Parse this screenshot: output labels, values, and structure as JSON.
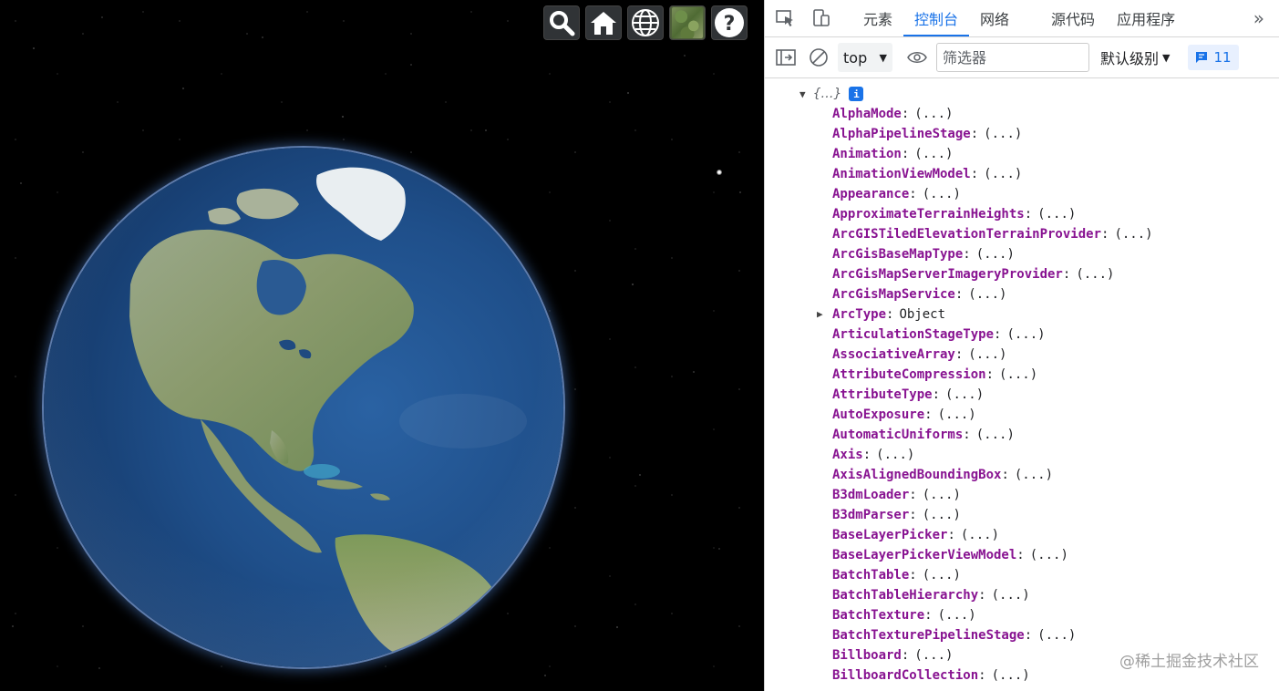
{
  "viewer": {
    "toolbar": [
      {
        "name": "search-button",
        "icon": "search-icon"
      },
      {
        "name": "home-button",
        "icon": "home-icon"
      },
      {
        "name": "scene-mode-button",
        "icon": "globe-icon"
      },
      {
        "name": "base-layer-picker-button",
        "icon": "imagery-thumbnail-icon"
      },
      {
        "name": "help-button",
        "icon": "question-mark-icon"
      }
    ]
  },
  "devtools": {
    "tabs": [
      "元素",
      "控制台",
      "网络",
      "源代码",
      "应用程序"
    ],
    "active_tab": "控制台",
    "more_icon": "»",
    "filterbar": {
      "context": "top",
      "filter_placeholder": "筛选器",
      "level": "默认级别",
      "message_count": "11"
    },
    "console": {
      "root_summary": "{…}",
      "root_info": "i",
      "placeholder_value": "(...)",
      "properties": [
        {
          "key": "AlphaMode",
          "value": "(...)"
        },
        {
          "key": "AlphaPipelineStage",
          "value": "(...)"
        },
        {
          "key": "Animation",
          "value": "(...)"
        },
        {
          "key": "AnimationViewModel",
          "value": "(...)"
        },
        {
          "key": "Appearance",
          "value": "(...)"
        },
        {
          "key": "ApproximateTerrainHeights",
          "value": "(...)"
        },
        {
          "key": "ArcGISTiledElevationTerrainProvider",
          "value": "(...)"
        },
        {
          "key": "ArcGisBaseMapType",
          "value": "(...)"
        },
        {
          "key": "ArcGisMapServerImageryProvider",
          "value": "(...)"
        },
        {
          "key": "ArcGisMapService",
          "value": "(...)"
        },
        {
          "key": "ArcType",
          "value": "Object",
          "expandable": true
        },
        {
          "key": "ArticulationStageType",
          "value": "(...)"
        },
        {
          "key": "AssociativeArray",
          "value": "(...)"
        },
        {
          "key": "AttributeCompression",
          "value": "(...)"
        },
        {
          "key": "AttributeType",
          "value": "(...)"
        },
        {
          "key": "AutoExposure",
          "value": "(...)"
        },
        {
          "key": "AutomaticUniforms",
          "value": "(...)"
        },
        {
          "key": "Axis",
          "value": "(...)"
        },
        {
          "key": "AxisAlignedBoundingBox",
          "value": "(...)"
        },
        {
          "key": "B3dmLoader",
          "value": "(...)"
        },
        {
          "key": "B3dmParser",
          "value": "(...)"
        },
        {
          "key": "BaseLayerPicker",
          "value": "(...)"
        },
        {
          "key": "BaseLayerPickerViewModel",
          "value": "(...)"
        },
        {
          "key": "BatchTable",
          "value": "(...)"
        },
        {
          "key": "BatchTableHierarchy",
          "value": "(...)"
        },
        {
          "key": "BatchTexture",
          "value": "(...)"
        },
        {
          "key": "BatchTexturePipelineStage",
          "value": "(...)"
        },
        {
          "key": "Billboard",
          "value": "(...)"
        },
        {
          "key": "BillboardCollection",
          "value": "(...)"
        }
      ]
    },
    "watermark": "@稀土掘金技术社区"
  }
}
